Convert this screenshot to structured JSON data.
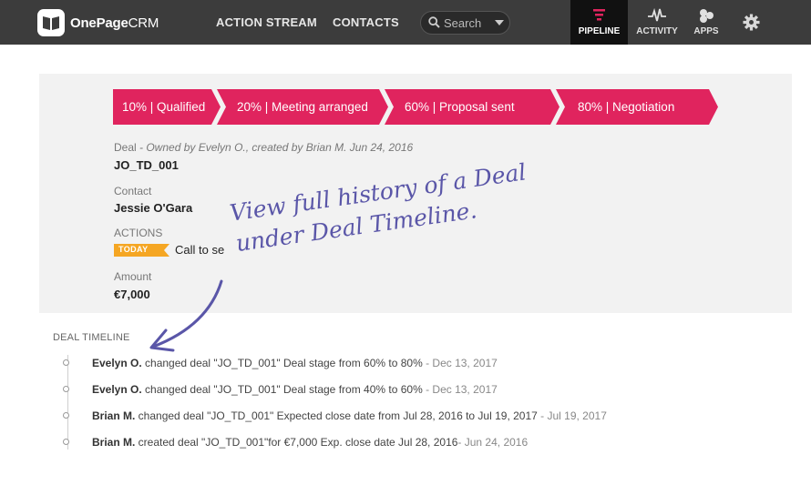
{
  "header": {
    "logo_name": "OnePage",
    "logo_suffix": "CRM",
    "nav": [
      "ACTION STREAM",
      "CONTACTS"
    ],
    "search_placeholder": "Search",
    "right_nav": {
      "pipeline": "PIPELINE",
      "activity": "ACTIVITY",
      "apps": "APPS"
    }
  },
  "deal": {
    "stages": [
      "10% | Qualified",
      "20% | Meeting arranged",
      "60% | Proposal sent",
      "80% | Negotiation"
    ],
    "type_label": "Deal",
    "owner_meta": " - Owned by Evelyn O., created by Brian M. Jun 24, 2016",
    "name": "JO_TD_001",
    "contact_label": "Contact",
    "contact_name": "Jessie O'Gara",
    "actions_label": "ACTIONS",
    "action_badge": "TODAY",
    "action_text": "Call to se",
    "amount_label": "Amount",
    "amount_value": "€7,000"
  },
  "annotation": {
    "line1": "View full history of a Deal",
    "line2": "under Deal Timeline."
  },
  "timeline": {
    "title": "DEAL TIMELINE",
    "items": [
      {
        "user": "Evelyn O.",
        "text": " changed deal \"JO_TD_001\" Deal stage from 60% to 80%",
        "date": " - Dec 13, 2017"
      },
      {
        "user": "Evelyn O.",
        "text": " changed deal \"JO_TD_001\" Deal stage from 40% to 60%",
        "date": " - Dec 13, 2017"
      },
      {
        "user": "Brian M.",
        "text": " changed deal \"JO_TD_001\" Expected close date from Jul 28, 2016 to Jul 19, 2017",
        "date": " - Jul 19, 2017"
      },
      {
        "user": "Brian M.",
        "text": " created deal \"JO_TD_001\"for €7,000 Exp. close date Jul 28, 2016",
        "date": "- Jun 24, 2016"
      }
    ]
  },
  "colors": {
    "topbar": "#3c3c3c",
    "stage": "#e0245e",
    "today": "#f5a623",
    "annotation": "#5a56a8"
  }
}
